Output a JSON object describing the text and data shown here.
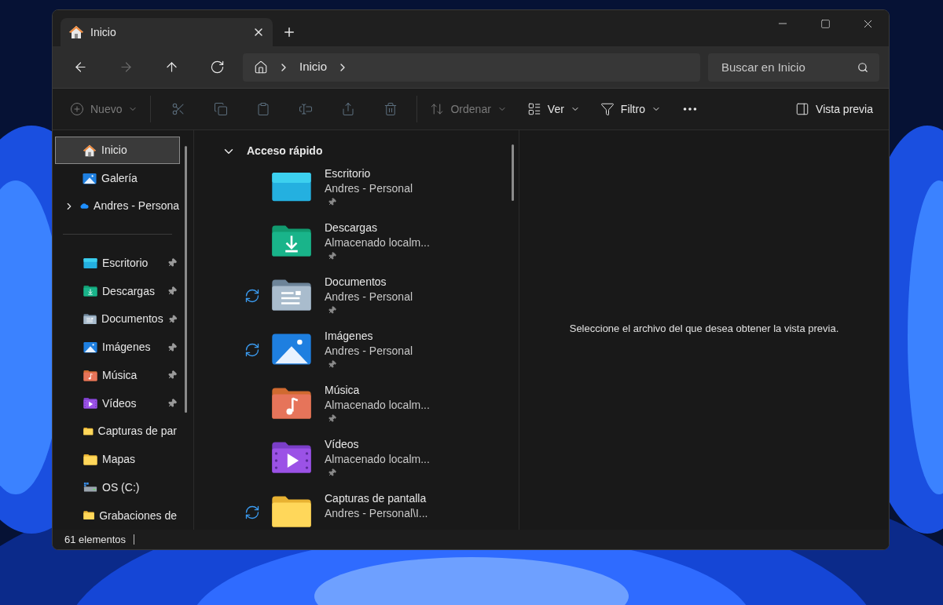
{
  "tab": {
    "title": "Inicio",
    "selected": true
  },
  "nav": [
    {
      "kind": "back",
      "disabled": false
    },
    {
      "kind": "forward",
      "disabled": true
    },
    {
      "kind": "up",
      "disabled": false
    },
    {
      "kind": "refresh",
      "disabled": false
    }
  ],
  "breadcrumb": [
    "Inicio"
  ],
  "search": {
    "placeholder": "Buscar en Inicio"
  },
  "toolbar": {
    "new": {
      "label": "Nuevo",
      "disabled": true
    },
    "actions": [
      {
        "kind": "cut",
        "disabled": true
      },
      {
        "kind": "copy",
        "disabled": true
      },
      {
        "kind": "paste",
        "disabled": true
      },
      {
        "kind": "rename",
        "disabled": true
      },
      {
        "kind": "share",
        "disabled": true
      },
      {
        "kind": "delete",
        "disabled": true
      }
    ],
    "menus": [
      {
        "kind": "sort",
        "label": "Ordenar",
        "disabled": true
      },
      {
        "kind": "view",
        "label": "Ver",
        "disabled": false
      },
      {
        "kind": "filter",
        "label": "Filtro",
        "disabled": false
      }
    ],
    "preview": {
      "label": "Vista previa"
    }
  },
  "sidebar": {
    "top": [
      {
        "label": "Inicio",
        "kind": "home",
        "selected": true,
        "expandable": false
      },
      {
        "label": "Galería",
        "kind": "gallery",
        "selected": false,
        "expandable": false
      },
      {
        "label": "Andres - Persona",
        "kind": "cloud",
        "selected": false,
        "expandable": true
      }
    ],
    "items": [
      {
        "label": "Escritorio",
        "kind": "desktop",
        "pinned": true,
        "selected": false
      },
      {
        "label": "Descargas",
        "kind": "downloads",
        "pinned": true,
        "selected": false
      },
      {
        "label": "Documentos",
        "kind": "documents",
        "pinned": true,
        "selected": false
      },
      {
        "label": "Imágenes",
        "kind": "pictures",
        "pinned": true,
        "selected": false
      },
      {
        "label": "Música",
        "kind": "music",
        "pinned": true,
        "selected": false
      },
      {
        "label": "Vídeos",
        "kind": "videos",
        "pinned": true,
        "selected": false
      },
      {
        "label": "Capturas de par",
        "kind": "folder",
        "pinned": false,
        "selected": false
      },
      {
        "label": "Mapas",
        "kind": "folder",
        "pinned": false,
        "selected": false
      },
      {
        "label": "OS (C:)",
        "kind": "drive",
        "pinned": false,
        "selected": false
      },
      {
        "label": "Grabaciones de",
        "kind": "folder",
        "pinned": false,
        "selected": false
      }
    ]
  },
  "quick_access": {
    "title": "Acceso rápido",
    "expanded": true,
    "items": [
      {
        "name": "Escritorio",
        "location": "Andres - Personal",
        "kind": "desktop",
        "syncing": false,
        "pinned": true
      },
      {
        "name": "Descargas",
        "location": "Almacenado localm...",
        "kind": "downloads",
        "syncing": false,
        "pinned": true
      },
      {
        "name": "Documentos",
        "location": "Andres - Personal",
        "kind": "documents",
        "syncing": true,
        "pinned": true
      },
      {
        "name": "Imágenes",
        "location": "Andres - Personal",
        "kind": "pictures",
        "syncing": true,
        "pinned": true
      },
      {
        "name": "Música",
        "location": "Almacenado localm...",
        "kind": "music",
        "syncing": false,
        "pinned": true
      },
      {
        "name": "Vídeos",
        "location": "Almacenado localm...",
        "kind": "videos",
        "syncing": false,
        "pinned": true
      },
      {
        "name": "Capturas de pantalla",
        "location": "Andres - Personal\\I...",
        "kind": "folder",
        "syncing": true,
        "pinned": false
      }
    ]
  },
  "preview_pane": {
    "message": "Seleccione el archivo del que desea obtener la vista previa."
  },
  "status_bar": {
    "count": "61 elementos"
  }
}
